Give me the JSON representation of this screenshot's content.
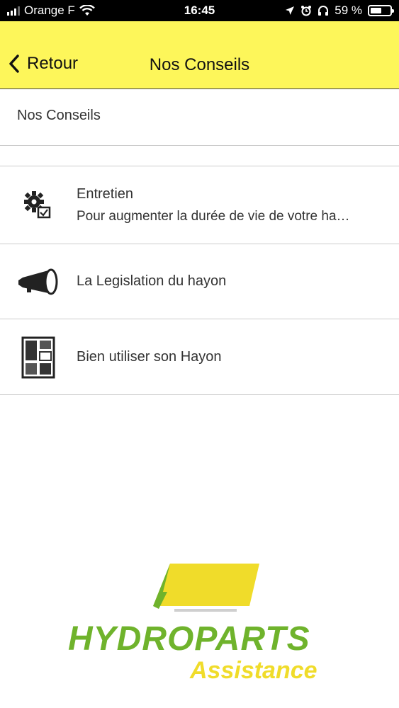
{
  "status_bar": {
    "carrier": "Orange F",
    "time": "16:45",
    "battery_text": "59 %",
    "battery_level": 0.59,
    "icons": [
      "signal-icon",
      "wifi-icon",
      "location-icon",
      "alarm-icon",
      "headphones-icon",
      "battery-icon"
    ]
  },
  "nav": {
    "back_label": "Retour",
    "title": "Nos Conseils",
    "background": "#fdf65a"
  },
  "section": {
    "header": "Nos Conseils"
  },
  "items": [
    {
      "icon": "gear-check-icon",
      "title": "Entretien",
      "subtitle": "Pour augmenter la durée de vie de votre ha…"
    },
    {
      "icon": "megaphone-icon",
      "title": "La Legislation du hayon"
    },
    {
      "icon": "layout-grid-icon",
      "title": "Bien utiliser son Hayon"
    }
  ],
  "logo": {
    "brand": "HYDROPARTS",
    "tagline": "Assistance",
    "colors": {
      "green": "#6fb32c",
      "yellow": "#f0dc2a"
    }
  }
}
